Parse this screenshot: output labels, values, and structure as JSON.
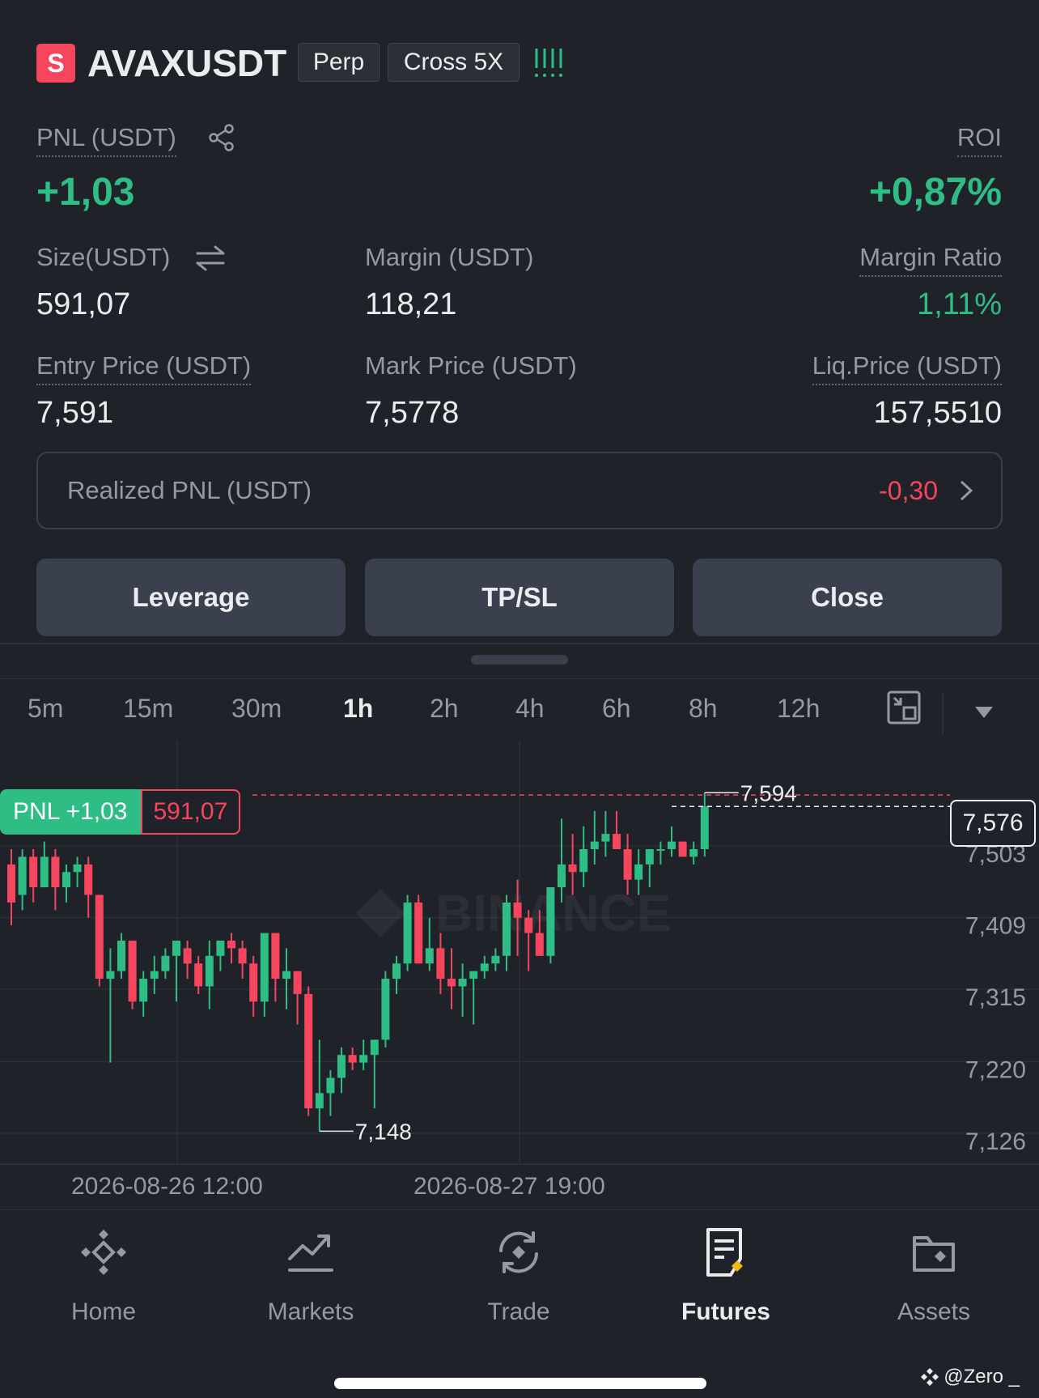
{
  "header": {
    "badge_letter": "S",
    "symbol": "AVAXUSDT",
    "contract_type": "Perp",
    "margin_mode": "Cross 5X"
  },
  "position": {
    "pnl_label": "PNL (USDT)",
    "pnl_value": "+1,03",
    "roi_label": "ROI",
    "roi_value": "+0,87%",
    "size_label": "Size(USDT)",
    "size_value": "591,07",
    "margin_label": "Margin (USDT)",
    "margin_value": "118,21",
    "margin_ratio_label": "Margin Ratio",
    "margin_ratio_value": "1,11%",
    "entry_label": "Entry Price (USDT)",
    "entry_value": "7,591",
    "mark_label": "Mark Price (USDT)",
    "mark_value": "7,5778",
    "liq_label": "Liq.Price (USDT)",
    "liq_value": "157,5510"
  },
  "realized": {
    "label": "Realized PNL (USDT)",
    "value": "-0,30"
  },
  "actions": {
    "leverage": "Leverage",
    "tpsl": "TP/SL",
    "close": "Close"
  },
  "timeframes": [
    "5m",
    "15m",
    "30m",
    "1h",
    "2h",
    "4h",
    "6h",
    "8h",
    "12h"
  ],
  "active_timeframe": "1h",
  "chart_data": {
    "type": "candlestick",
    "interval": "1h",
    "y_ticks": [
      "7,503",
      "7,409",
      "7,315",
      "7,220",
      "7,126"
    ],
    "y_ticks_values": [
      7.503,
      7.409,
      7.315,
      7.22,
      7.126
    ],
    "x_labels": [
      "2026-08-26 12:00",
      "2026-08-27 19:00"
    ],
    "high_label": "7,594",
    "low_label": "7,148",
    "current_price_label": "7,576",
    "position_tag": {
      "pnl": "PNL +1,03",
      "size": "591,07"
    },
    "watermark": "BINANCE",
    "colors": {
      "up": "#2ebd85",
      "down": "#f6465d"
    },
    "candles": [
      [
        7.5,
        7.52,
        7.42,
        7.45
      ],
      [
        7.46,
        7.52,
        7.44,
        7.51
      ],
      [
        7.51,
        7.52,
        7.45,
        7.47
      ],
      [
        7.47,
        7.53,
        7.47,
        7.51
      ],
      [
        7.51,
        7.52,
        7.44,
        7.47
      ],
      [
        7.47,
        7.5,
        7.45,
        7.49
      ],
      [
        7.49,
        7.51,
        7.47,
        7.5
      ],
      [
        7.5,
        7.51,
        7.43,
        7.46
      ],
      [
        7.46,
        7.46,
        7.34,
        7.35
      ],
      [
        7.35,
        7.39,
        7.24,
        7.36
      ],
      [
        7.36,
        7.41,
        7.35,
        7.4
      ],
      [
        7.4,
        7.4,
        7.31,
        7.32
      ],
      [
        7.32,
        7.36,
        7.3,
        7.35
      ],
      [
        7.35,
        7.38,
        7.33,
        7.36
      ],
      [
        7.36,
        7.39,
        7.35,
        7.38
      ],
      [
        7.38,
        7.4,
        7.32,
        7.4
      ],
      [
        7.39,
        7.4,
        7.35,
        7.37
      ],
      [
        7.37,
        7.38,
        7.33,
        7.34
      ],
      [
        7.34,
        7.4,
        7.31,
        7.38
      ],
      [
        7.38,
        7.4,
        7.36,
        7.4
      ],
      [
        7.4,
        7.41,
        7.37,
        7.39
      ],
      [
        7.39,
        7.4,
        7.35,
        7.37
      ],
      [
        7.37,
        7.38,
        7.3,
        7.32
      ],
      [
        7.32,
        7.4,
        7.3,
        7.41
      ],
      [
        7.41,
        7.41,
        7.32,
        7.35
      ],
      [
        7.35,
        7.39,
        7.31,
        7.36
      ],
      [
        7.36,
        7.36,
        7.29,
        7.33
      ],
      [
        7.33,
        7.34,
        7.17,
        7.18
      ],
      [
        7.18,
        7.27,
        7.15,
        7.2
      ],
      [
        7.2,
        7.23,
        7.17,
        7.22
      ],
      [
        7.22,
        7.26,
        7.2,
        7.25
      ],
      [
        7.25,
        7.26,
        7.23,
        7.24
      ],
      [
        7.24,
        7.27,
        7.23,
        7.25
      ],
      [
        7.25,
        7.27,
        7.18,
        7.27
      ],
      [
        7.27,
        7.36,
        7.26,
        7.35
      ],
      [
        7.35,
        7.38,
        7.33,
        7.37
      ],
      [
        7.37,
        7.46,
        7.36,
        7.45
      ],
      [
        7.45,
        7.46,
        7.37,
        7.37
      ],
      [
        7.37,
        7.43,
        7.36,
        7.39
      ],
      [
        7.39,
        7.41,
        7.33,
        7.35
      ],
      [
        7.35,
        7.39,
        7.31,
        7.34
      ],
      [
        7.34,
        7.37,
        7.3,
        7.35
      ],
      [
        7.35,
        7.36,
        7.29,
        7.36
      ],
      [
        7.36,
        7.38,
        7.35,
        7.37
      ],
      [
        7.37,
        7.39,
        7.36,
        7.38
      ],
      [
        7.38,
        7.46,
        7.36,
        7.45
      ],
      [
        7.45,
        7.48,
        7.38,
        7.43
      ],
      [
        7.43,
        7.44,
        7.36,
        7.41
      ],
      [
        7.41,
        7.44,
        7.38,
        7.38
      ],
      [
        7.38,
        7.43,
        7.37,
        7.47
      ],
      [
        7.47,
        7.56,
        7.45,
        7.5
      ],
      [
        7.5,
        7.54,
        7.46,
        7.49
      ],
      [
        7.49,
        7.55,
        7.47,
        7.52
      ],
      [
        7.52,
        7.57,
        7.5,
        7.53
      ],
      [
        7.53,
        7.57,
        7.51,
        7.54
      ],
      [
        7.54,
        7.57,
        7.52,
        7.52
      ],
      [
        7.52,
        7.54,
        7.46,
        7.48
      ],
      [
        7.48,
        7.52,
        7.46,
        7.5
      ],
      [
        7.5,
        7.52,
        7.47,
        7.52
      ],
      [
        7.52,
        7.53,
        7.5,
        7.52
      ],
      [
        7.52,
        7.55,
        7.51,
        7.53
      ],
      [
        7.53,
        7.53,
        7.51,
        7.51
      ],
      [
        7.51,
        7.53,
        7.5,
        7.52
      ],
      [
        7.52,
        7.594,
        7.51,
        7.576
      ]
    ]
  },
  "nav": {
    "home": "Home",
    "markets": "Markets",
    "trade": "Trade",
    "futures": "Futures",
    "assets": "Assets"
  },
  "watermark_user": "@Zero _"
}
